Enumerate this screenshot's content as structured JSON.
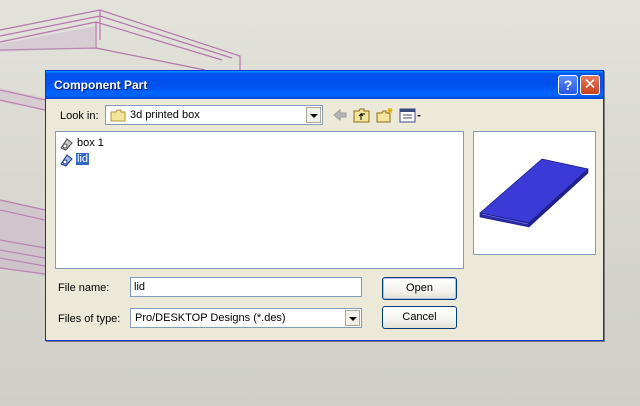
{
  "dialog": {
    "title": "Component Part",
    "help_glyph": "?",
    "close_glyph": "✕"
  },
  "look_in": {
    "label": "Look in:",
    "value": "3d printed box"
  },
  "toolbar": {
    "icons": [
      "back-icon",
      "up-folder-icon",
      "new-folder-icon",
      "view-menu-icon"
    ]
  },
  "files": [
    {
      "name": "box 1",
      "icon": "part-design-icon",
      "selected": false
    },
    {
      "name": "lid",
      "icon": "part-design-icon",
      "selected": true
    }
  ],
  "file_name": {
    "label": "File name:",
    "value": "lid"
  },
  "file_type": {
    "label": "Files of type:",
    "value": "Pro/DESKTOP Designs (*.des)"
  },
  "buttons": {
    "open": "Open",
    "cancel": "Cancel"
  },
  "colors": {
    "titlebar": "#0055ea",
    "selection": "#316ac5",
    "preview_part": "#3a3ad6"
  }
}
